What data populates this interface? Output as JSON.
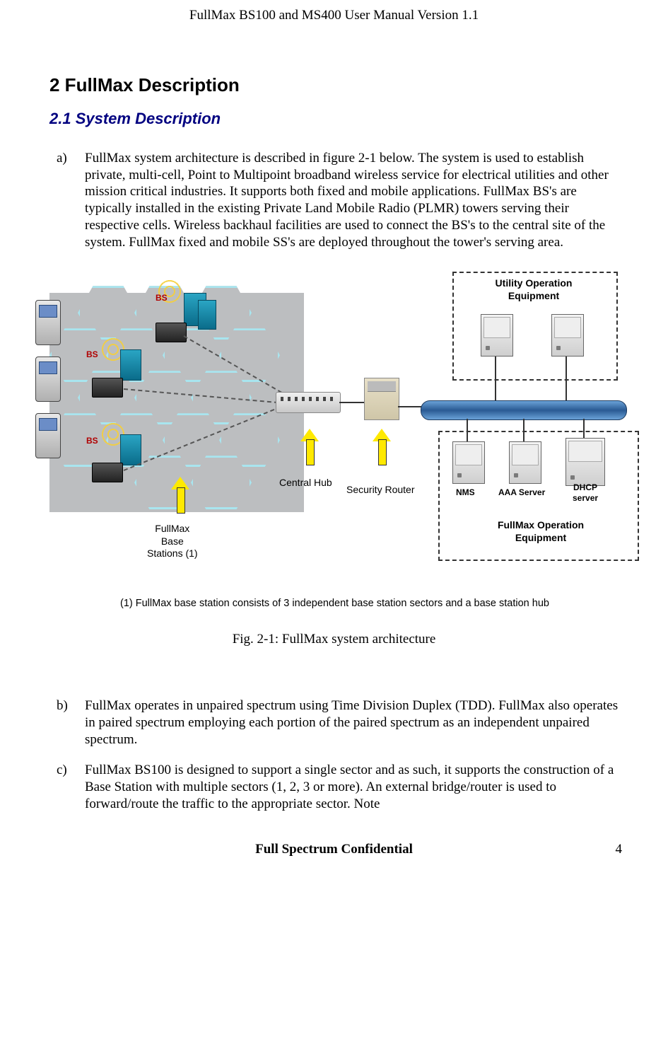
{
  "header": "FullMax BS100 and MS400 User Manual Version 1.1",
  "h1": "2   FullMax Description",
  "h2": "2.1  System Description",
  "para_a_marker": "a)",
  "para_a": "FullMax system architecture is described in figure 2-1 below. The system is used to establish private, multi-cell, Point to Multipoint broadband wireless service for electrical utilities and other mission critical industries. It supports both fixed and mobile applications. FullMax BS's are typically installed in the existing Private Land Mobile Radio (PLMR) towers serving their respective cells. Wireless backhaul facilities are used to connect the BS's to the central site of the system. FullMax fixed and mobile SS's are deployed throughout the tower's serving area.",
  "diagram": {
    "bs": "BS",
    "central_hub": "Central Hub",
    "security_router": "Security Router",
    "fullmax_base_stations": "FullMax\nBase\nStations (1)",
    "utility_op": "Utility Operation\nEquipment",
    "fullmax_op": "FullMax Operation\nEquipment",
    "nms": "NMS",
    "aaa": "AAA Server",
    "dhcp": "DHCP\nserver"
  },
  "footnote": "(1) FullMax base station consists of 3 independent base station sectors and a base station hub",
  "figcap": "Fig. 2-1: FullMax system architecture",
  "para_b_marker": "b)",
  "para_b": "FullMax operates in unpaired spectrum using Time Division Duplex (TDD). FullMax also operates in paired spectrum employing each portion of the paired spectrum as an independent unpaired spectrum.",
  "para_c_marker": "c)",
  "para_c": "FullMax BS100 is designed to support a single sector and as such, it supports the construction of a Base Station with multiple sectors (1, 2, 3 or more). An external bridge/router is used to forward/route the traffic to the appropriate sector. Note",
  "footer": "Full Spectrum Confidential",
  "pagenum": "4"
}
